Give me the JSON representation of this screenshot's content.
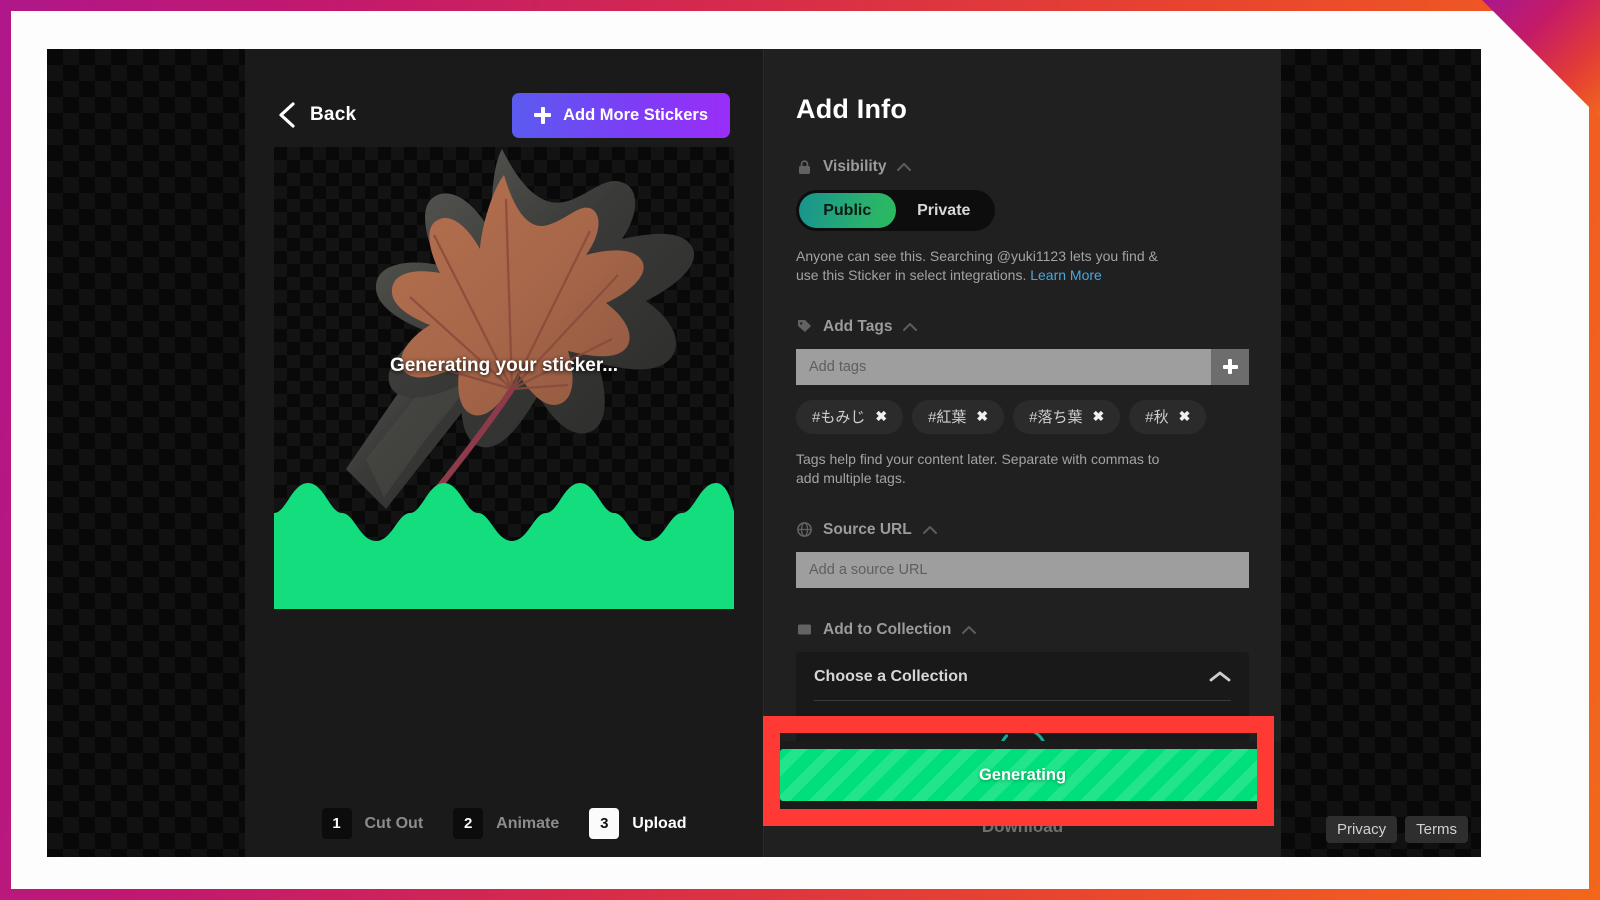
{
  "editor": {
    "back_label": "Back",
    "add_stickers_label": "Add More Stickers",
    "generating_overlay_text": "Generating your sticker...",
    "steps": [
      {
        "number": "1",
        "label": "Cut Out",
        "active": false
      },
      {
        "number": "2",
        "label": "Animate",
        "active": false
      },
      {
        "number": "3",
        "label": "Upload",
        "active": true
      }
    ]
  },
  "info": {
    "title": "Add Info",
    "visibility": {
      "icon": "lock-icon",
      "label": "Visibility",
      "options": [
        "Public",
        "Private"
      ],
      "selected": "Public",
      "helper_prefix": "Anyone can see this. Searching @yuki1123 lets you find & use this Sticker in select integrations. ",
      "helper_link": "Learn More"
    },
    "tags": {
      "icon": "tag-icon",
      "label": "Add Tags",
      "input_placeholder": "Add tags",
      "input_value": "",
      "add_button": "plus-icon",
      "chips": [
        "#もみじ",
        "#紅葉",
        "#落ち葉",
        "#秋"
      ],
      "chip_remove_glyph": "✖",
      "helper": "Tags help find your content later. Separate with commas to add multiple tags."
    },
    "source_url": {
      "icon": "globe-icon",
      "label": "Source URL",
      "input_placeholder": "Add a source URL",
      "input_value": ""
    },
    "collection": {
      "icon": "collection-icon",
      "label": "Add to Collection",
      "chooser_label": "Choose a Collection",
      "loading": true
    },
    "primary_action": "Generating",
    "download_label": "Download"
  },
  "footer": {
    "privacy": "Privacy",
    "terms": "Terms"
  },
  "colors": {
    "accent_green": "#00e07a",
    "annotation_red": "#ff3a34",
    "link_blue": "#4aa6dd",
    "sticker_gradient_start": "#5b5bf0",
    "sticker_gradient_end": "#9a2ef8",
    "public_pill_start": "#19938f",
    "public_pill_end": "#2cba5d",
    "frame_gradient_start": "#b0178a",
    "frame_gradient_end": "#f2671c"
  }
}
